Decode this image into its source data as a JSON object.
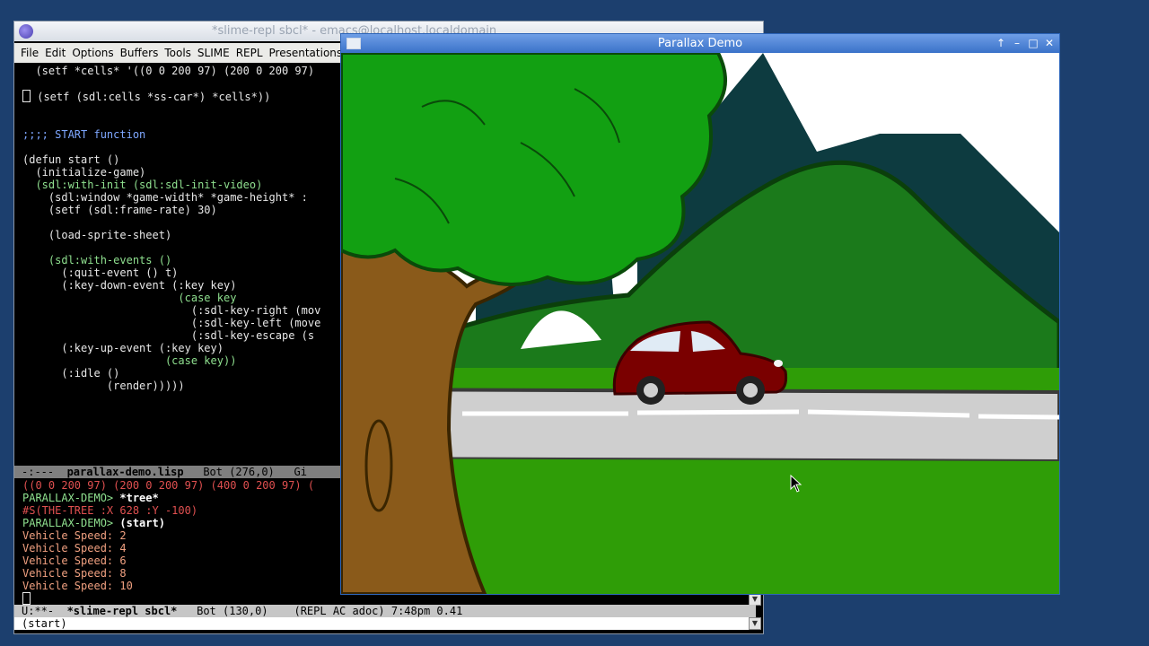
{
  "emacs": {
    "title": "*slime-repl sbcl* - emacs@localhost.localdomain",
    "menu": [
      "File",
      "Edit",
      "Options",
      "Buffers",
      "Tools",
      "SLIME",
      "REPL",
      "Presentations"
    ],
    "code": {
      "line1": "  (setf *cells* '((0 0 200 97) (200 0 200 97)",
      "line2": " (setf (sdl:cells *ss-car*) *cells*))",
      "comment": ";;;; START function",
      "defun": "(defun start ()",
      "init_game": "  (initialize-game)",
      "with_init": "  (sdl:with-init (sdl:sdl-init-video)",
      "window": "    (sdl:window *game-width* *game-height* :",
      "frame_rate": "    (setf (sdl:frame-rate) 30)",
      "load_sheet": "    (load-sprite-sheet)",
      "with_events": "    (sdl:with-events ()",
      "quit_event": "      (:quit-event () t)",
      "key_down": "      (:key-down-event (:key key)",
      "case_key": "                        (case key",
      "key_right": "                          (:sdl-key-right (mov",
      "key_left": "                          (:sdl-key-left (move",
      "key_escape": "                          (:sdl-key-escape (s",
      "key_up": "      (:key-up-event (:key key)",
      "case_key2": "                      (case key))",
      "idle": "      (:idle ()",
      "render": "             (render)))))"
    },
    "modeline1": {
      "status": "-:---",
      "buffer": "parallax-demo.lisp",
      "position": "Bot (276,0)",
      "vc": "Gi"
    },
    "repl": {
      "cells_output": "((0 0 200 97) (200 0 200 97) (400 0 200 97) (",
      "prompt1": "PARALLAX-DEMO> ",
      "input1": "*tree*",
      "tree_output": "#S(THE-TREE :X 628 :Y -100)",
      "prompt2": "PARALLAX-DEMO> ",
      "input2": "(start)",
      "speeds": [
        "Vehicle Speed: 2",
        "Vehicle Speed: 4",
        "Vehicle Speed: 6",
        "Vehicle Speed: 8",
        "Vehicle Speed: 10"
      ]
    },
    "modeline2": {
      "status": "U:**-",
      "buffer": "*slime-repl sbcl*",
      "position": "Bot (130,0)",
      "modes": "(REPL AC adoc) 7:48pm 0.41"
    },
    "minibuffer": "(start)"
  },
  "parallax": {
    "title": "Parallax Demo",
    "buttons": {
      "up": "↑",
      "minimize": "–",
      "maximize": "□",
      "close": "✕"
    }
  },
  "colors": {
    "sky": "#ffffff",
    "mountain": "#0d3b40",
    "hill": "#1b7a1b",
    "grass": "#2f9d07",
    "road": "#cfcfcf",
    "car": "#7a0000",
    "tree_trunk": "#8a5a1a",
    "foliage": "#12a012"
  }
}
